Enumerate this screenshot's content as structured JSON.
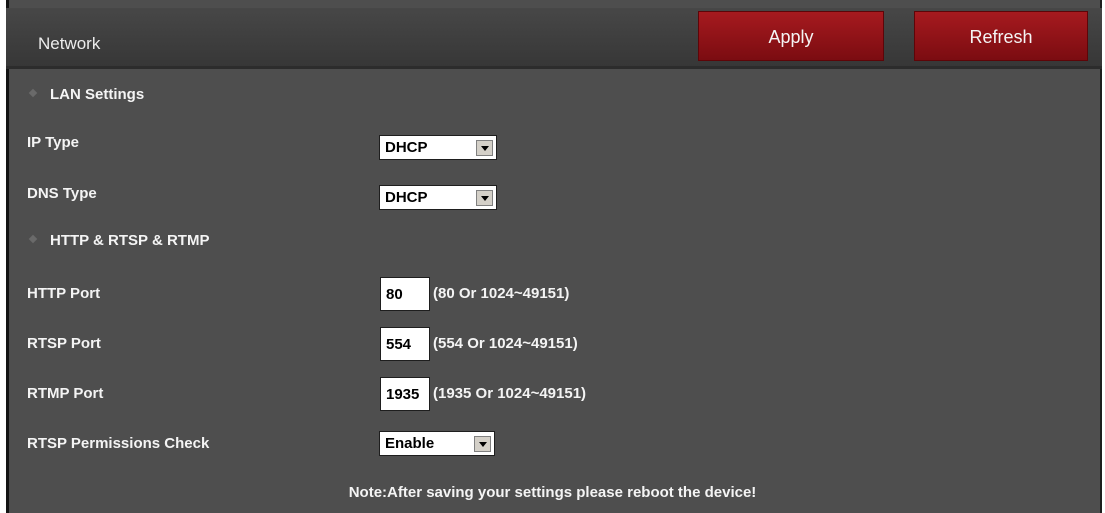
{
  "header": {
    "title": "Network",
    "apply_label": "Apply",
    "refresh_label": "Refresh"
  },
  "sections": {
    "lan": "LAN Settings",
    "http": "HTTP & RTSP & RTMP"
  },
  "fields": {
    "ip_type": {
      "label": "IP Type",
      "value": "DHCP"
    },
    "dns_type": {
      "label": "DNS Type",
      "value": "DHCP"
    },
    "http_port": {
      "label": "HTTP Port",
      "value": "80",
      "hint": "(80 Or 1024~49151)"
    },
    "rtsp_port": {
      "label": "RTSP Port",
      "value": "554",
      "hint": "(554 Or 1024~49151)"
    },
    "rtmp_port": {
      "label": "RTMP Port",
      "value": "1935",
      "hint": "(1935 Or 1024~49151)"
    },
    "rtsp_check": {
      "label": "RTSP Permissions Check",
      "value": "Enable"
    }
  },
  "note": "Note:After saving your settings please reboot the device!",
  "colors": {
    "panel": "#4e4e4e",
    "header": "#3f3f3f",
    "button": "#8e1016",
    "text": "#f4f4f4"
  },
  "icons": {
    "section_bullet": "diamond-icon",
    "dropdown": "chevron-down-icon"
  }
}
